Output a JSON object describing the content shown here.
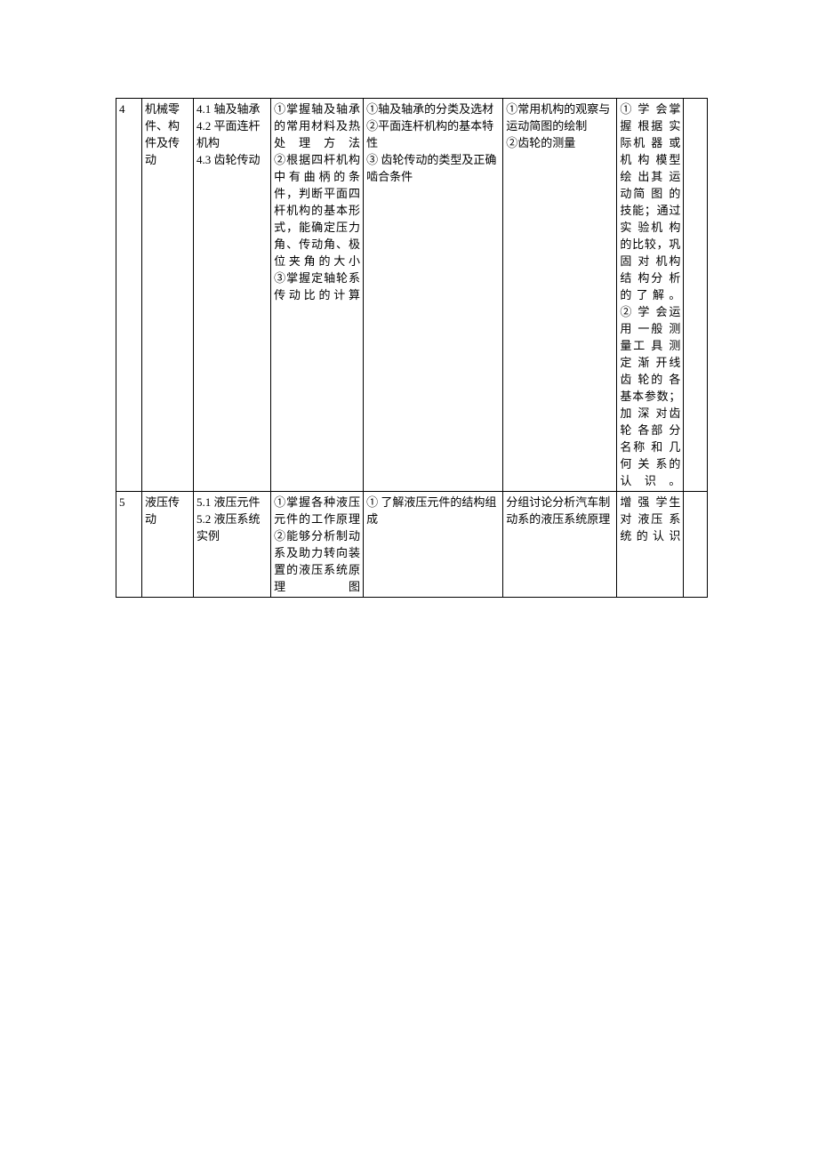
{
  "rows": [
    {
      "num": "4",
      "topic": "机械零件、构件及传动",
      "sub": "4.1 轴及轴承\n4.2 平面连杆机构\n4.3 齿轮传动",
      "grasp": "①掌握轴及轴承的常用材料及热处理方法\n②根据四杆机构中有曲柄的条件，判断平面四杆机构的基本形式，能确定压力角、传动角、极位夹角的大小\n③掌握定轴轮系传动比的计算",
      "know": "①轴及轴承的分类及选材\n②平面连杆机构的基本特性\n③ 齿轮传动的类型及正确啮合条件",
      "disc": "①常用机构的观察与运动简图的绘制\n②齿轮的测量",
      "skill": "① 学 会掌 握 根据 实 际机 器 或机 构 模型 绘 出其 运 动简 图 的技能；通过 实 验机 构 的比较，巩固 对 机构 结 构分 析 的了解。\n② 学 会运 用 一般 测 量工 具 测定 渐 开线 齿 轮的 各 基本参数；加 深 对齿 轮 各部 分 名称 和 几何 关 系的认识。",
      "last": ""
    },
    {
      "num": "5",
      "topic": "液压传动",
      "sub": "5.1 液压元件\n5.2 液压系统实例",
      "grasp": "①掌握各种液压元件的工作原理\n②能够分析制动系及助力转向装置的液压系统原理图",
      "know": "① 了解液压元件的结构组成",
      "disc": "分组讨论分析汽车制动系的液压系统原理",
      "skill": "增 强 学生 对 液压 系 统的认识",
      "last": ""
    }
  ]
}
